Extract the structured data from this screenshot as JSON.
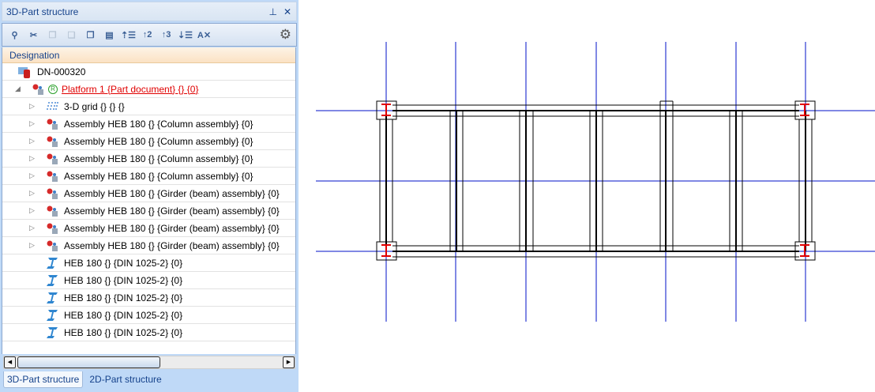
{
  "panel": {
    "title": "3D-Part structure",
    "pin_icon": "pin-icon",
    "close_icon": "close-icon",
    "toolbar": [
      {
        "name": "find",
        "icon": "magnifier-icon",
        "glyph": "⚲",
        "enabled": true
      },
      {
        "name": "cut",
        "icon": "scissors-icon",
        "glyph": "✂",
        "enabled": true
      },
      {
        "name": "copy",
        "icon": "copy-icon",
        "glyph": "❐",
        "enabled": false
      },
      {
        "name": "paste",
        "icon": "paste-icon",
        "glyph": "❏",
        "enabled": false
      },
      {
        "name": "copy-special",
        "icon": "copy-special-icon",
        "glyph": "❐",
        "enabled": true
      },
      {
        "name": "paste-special",
        "icon": "paste-special-icon",
        "glyph": "▤",
        "enabled": true
      },
      {
        "name": "collapse-1",
        "icon": "collapse-level-icon",
        "glyph": "⇡☰",
        "enabled": true
      },
      {
        "name": "level-2",
        "icon": "level-2-icon",
        "glyph": "↑2",
        "enabled": true
      },
      {
        "name": "level-3",
        "icon": "level-3-icon",
        "glyph": "↑3",
        "enabled": true
      },
      {
        "name": "expand-all",
        "icon": "expand-all-icon",
        "glyph": "⇣☰",
        "enabled": true
      },
      {
        "name": "sort-clear",
        "icon": "sort-az-clear-icon",
        "glyph": "A✕",
        "enabled": true
      }
    ],
    "column_header": "Designation",
    "rows": [
      {
        "level": 0,
        "expander": "",
        "icon": "document-icon",
        "text": "DN-000320"
      },
      {
        "level": 1,
        "expander": "◢",
        "icon": "assembly-icon",
        "badge": "R",
        "text": "Platform 1 {Part document} {} {0}",
        "link": true
      },
      {
        "level": 2,
        "expander": "▷",
        "icon": "grid-icon",
        "text": "3-D grid {} {} {}"
      },
      {
        "level": 2,
        "expander": "▷",
        "icon": "assembly-icon",
        "text": "Assembly HEB 180 {} {Column assembly} {0}"
      },
      {
        "level": 2,
        "expander": "▷",
        "icon": "assembly-icon",
        "text": "Assembly HEB 180 {} {Column assembly} {0}"
      },
      {
        "level": 2,
        "expander": "▷",
        "icon": "assembly-icon",
        "text": "Assembly HEB 180 {} {Column assembly} {0}"
      },
      {
        "level": 2,
        "expander": "▷",
        "icon": "assembly-icon",
        "text": "Assembly HEB 180 {} {Column assembly} {0}"
      },
      {
        "level": 2,
        "expander": "▷",
        "icon": "assembly-icon",
        "text": "Assembly HEB 180 {} {Girder (beam) assembly} {0}"
      },
      {
        "level": 2,
        "expander": "▷",
        "icon": "assembly-icon",
        "text": "Assembly HEB 180 {} {Girder (beam) assembly} {0}"
      },
      {
        "level": 2,
        "expander": "▷",
        "icon": "assembly-icon",
        "text": "Assembly HEB 180 {} {Girder (beam) assembly} {0}"
      },
      {
        "level": 2,
        "expander": "▷",
        "icon": "assembly-icon",
        "text": "Assembly HEB 180 {} {Girder (beam) assembly} {0}"
      },
      {
        "level": 2,
        "expander": "",
        "icon": "i-beam-icon",
        "text": "HEB 180 {} {DIN 1025-2} {0}"
      },
      {
        "level": 2,
        "expander": "",
        "icon": "i-beam-icon",
        "text": "HEB 180 {} {DIN 1025-2} {0}"
      },
      {
        "level": 2,
        "expander": "",
        "icon": "i-beam-icon",
        "text": "HEB 180 {} {DIN 1025-2} {0}"
      },
      {
        "level": 2,
        "expander": "",
        "icon": "i-beam-icon",
        "text": "HEB 180 {} {DIN 1025-2} {0}"
      },
      {
        "level": 2,
        "expander": "",
        "icon": "i-beam-icon",
        "text": "HEB 180 {} {DIN 1025-2} {0}"
      }
    ],
    "tabs": [
      {
        "label": "3D-Part structure",
        "active": true
      },
      {
        "label": "2D-Part structure",
        "active": false
      }
    ]
  },
  "colors": {
    "grid_line": "#0010c8",
    "link": "#e00000",
    "accent": "#15428b"
  }
}
